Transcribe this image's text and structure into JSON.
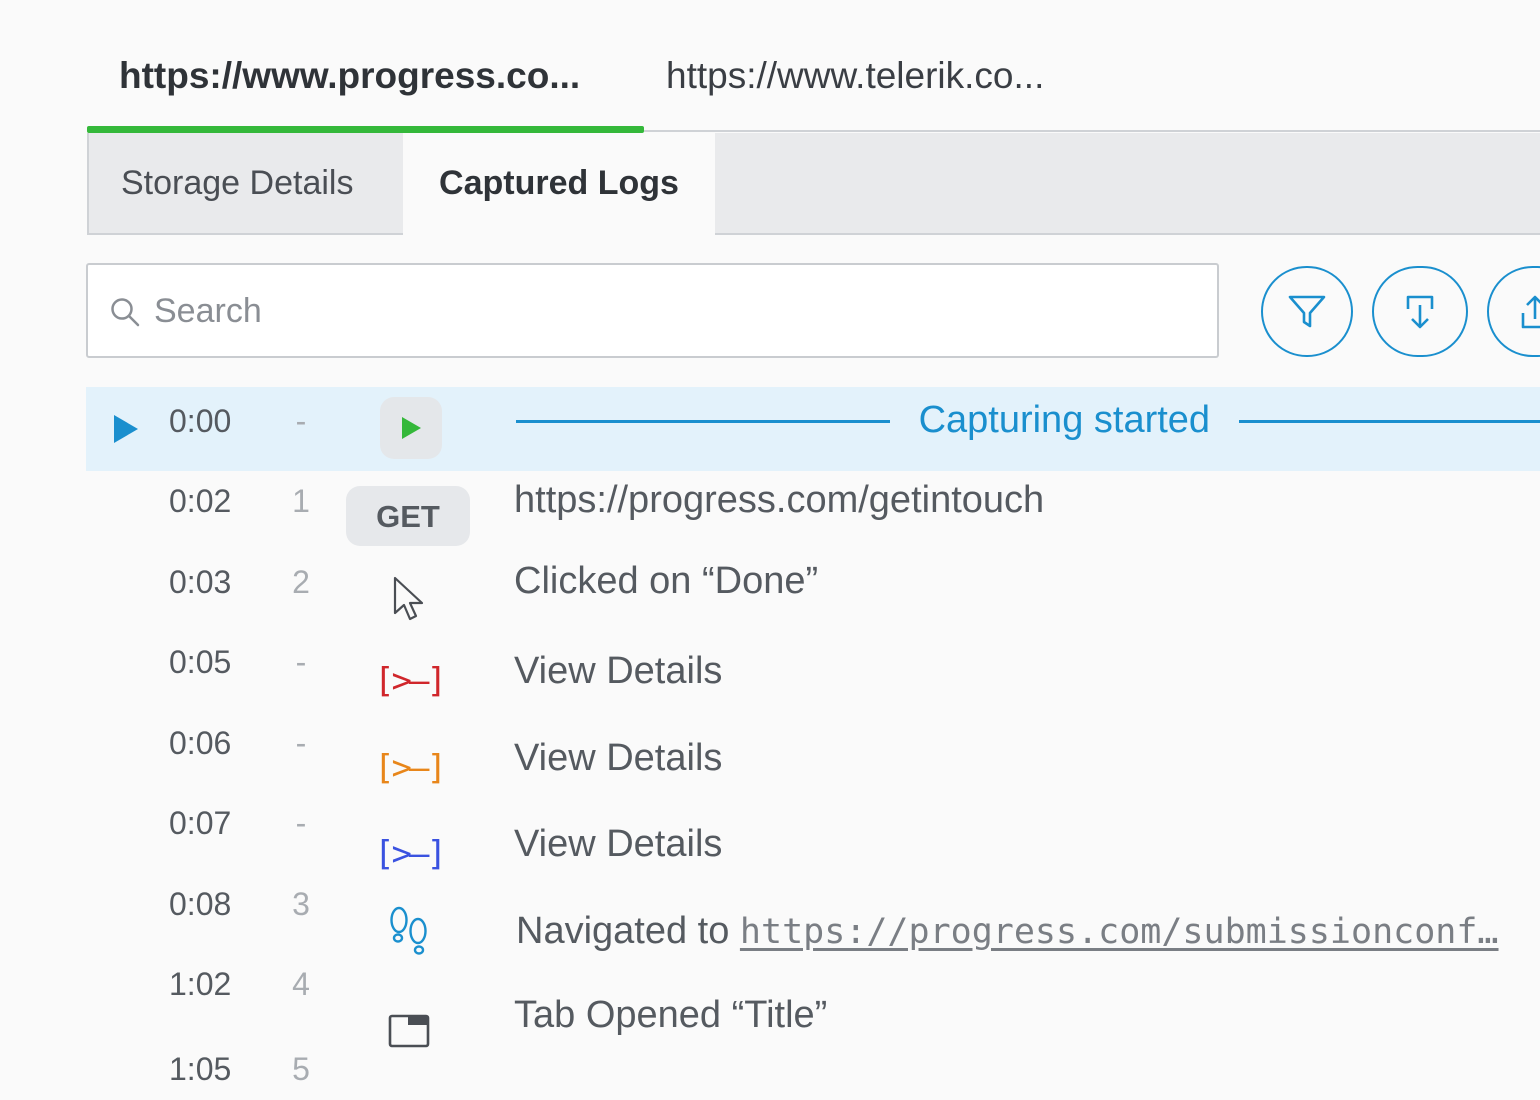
{
  "browser_tabs": [
    {
      "label": "https://www.progress.co...",
      "active": true
    },
    {
      "label": "https://www.telerik.co...",
      "active": false
    }
  ],
  "subtabs": {
    "storage": "Storage Details",
    "captured": "Captured Logs"
  },
  "search": {
    "placeholder": "Search"
  },
  "toolbar": {
    "filter_icon": "filter-icon",
    "download_icon": "download-icon",
    "upload_icon": "upload-icon"
  },
  "colors": {
    "accent": "#1a8fce",
    "tab_underline": "#34b83a",
    "active_row": "#e3f2fb",
    "console_red": "#d0262b",
    "console_orange": "#e8861a",
    "console_blue": "#3a52e0",
    "play_green": "#34b83a"
  },
  "logs": [
    {
      "time": "0:00",
      "step": "-",
      "icon": "play-icon",
      "text": "Capturing started",
      "active": true
    },
    {
      "time": "0:02",
      "step": "1",
      "icon": "GET",
      "text": "https://progress.com/getintouch"
    },
    {
      "time": "0:03",
      "step": "2",
      "icon": "cursor-icon",
      "text": "Clicked on “Done”"
    },
    {
      "time": "0:05",
      "step": "-",
      "icon": "console-icon-red",
      "glyph": "[>–]",
      "text": "View Details"
    },
    {
      "time": "0:06",
      "step": "-",
      "icon": "console-icon-orange",
      "glyph": "[>–]",
      "text": "View Details"
    },
    {
      "time": "0:07",
      "step": "-",
      "icon": "console-icon-blue",
      "glyph": "[>–]",
      "text": "View Details"
    },
    {
      "time": "0:08",
      "step": "3",
      "icon": "footsteps-icon",
      "text_prefix": "Navigated to ",
      "link": "https://progress.com/submissionconf…"
    },
    {
      "time": "1:02",
      "step": "4",
      "icon": "tab-window-icon",
      "text": "Tab Opened “Title”"
    },
    {
      "time": "1:05",
      "step": "5"
    }
  ]
}
